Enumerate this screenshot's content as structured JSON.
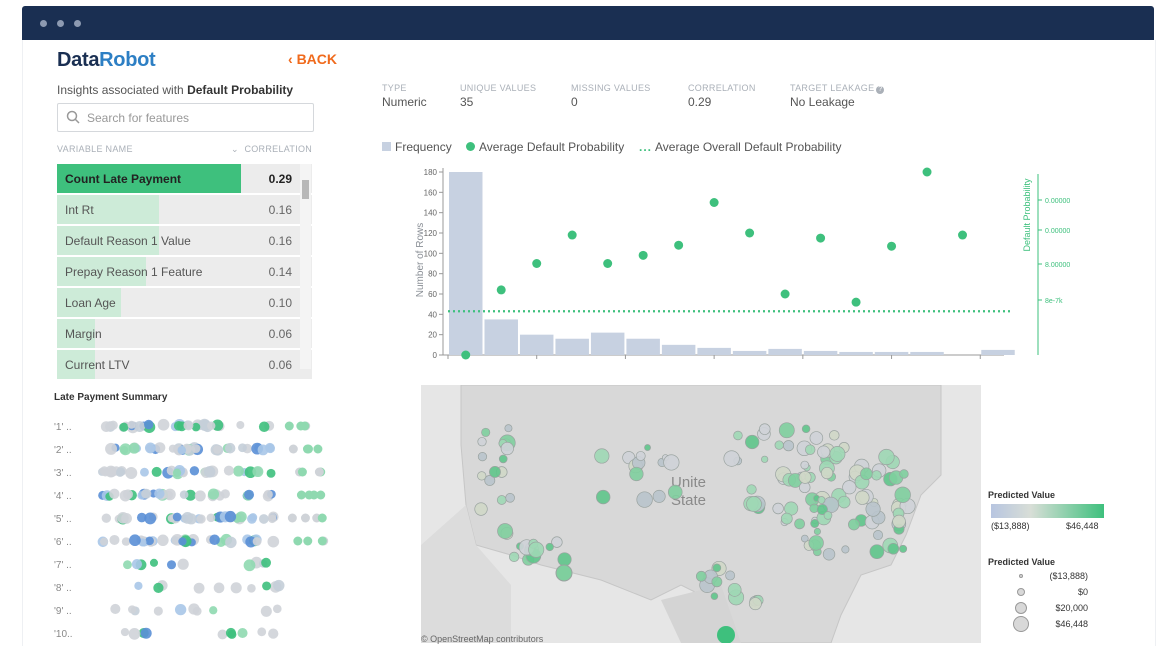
{
  "window": {
    "dots": [
      "dot",
      "dot",
      "dot"
    ]
  },
  "app": {
    "logo_data": "Data",
    "logo_robot": "Robot",
    "back_label": "BACK",
    "back_icon": "chevron-left-icon"
  },
  "insights": {
    "prefix": "Insights associated with ",
    "target": "Default Probability"
  },
  "search": {
    "placeholder": "Search for features",
    "icon": "search-icon"
  },
  "feature_table": {
    "col_name": "VARIABLE NAME",
    "col_corr": "CORRELATION",
    "sort_icon": "chevron-down-icon",
    "rows": [
      {
        "name": "Count Late Payment",
        "value": "0.29",
        "corr": 0.29,
        "selected": true
      },
      {
        "name": "Int Rt",
        "value": "0.16",
        "corr": 0.16
      },
      {
        "name": "Default Reason 1 Value",
        "value": "0.16",
        "corr": 0.16
      },
      {
        "name": "Prepay Reason 1 Feature",
        "value": "0.14",
        "corr": 0.14
      },
      {
        "name": "Loan Age",
        "value": "0.10",
        "corr": 0.1
      },
      {
        "name": "Margin",
        "value": "0.06",
        "corr": 0.06
      },
      {
        "name": "Current LTV",
        "value": "0.06",
        "corr": 0.06
      }
    ]
  },
  "stats": [
    {
      "label": "TYPE",
      "value": "Numeric"
    },
    {
      "label": "UNIQUE VALUES",
      "value": "35"
    },
    {
      "label": "MISSING VALUES",
      "value": "0"
    },
    {
      "label": "CORRELATION",
      "value": "0.29"
    },
    {
      "label": "TARGET LEAKAGE",
      "value": "No Leakage",
      "icon": "help-icon"
    }
  ],
  "legend": {
    "frequency": "Frequency",
    "avg_default": "Average Default Probability",
    "avg_overall": "Average Overall Default Probability"
  },
  "colors": {
    "accent": "#3ec07d",
    "bar": "#c7d1e1",
    "navy": "#1a2f52",
    "back": "#f06a1c"
  },
  "chart_data": {
    "type": "bar",
    "ylabel": "Number of Rows",
    "y2label": "Default Probability",
    "xlim": [
      0,
      31
    ],
    "ylim": [
      0,
      180
    ],
    "x_ticks": [
      "0",
      "5",
      "10",
      "15",
      "20",
      "25",
      "30"
    ],
    "y_ticks": [
      "0",
      "20",
      "40",
      "60",
      "80",
      "100",
      "120",
      "140",
      "160",
      "180"
    ],
    "y2_ticks": [
      "0.00000",
      "0.00000",
      "8.00000",
      "8e-7k"
    ],
    "series": [
      {
        "type": "bar",
        "x_start": [
          0,
          2,
          4,
          6,
          8,
          10,
          12,
          14,
          16,
          18,
          20,
          22,
          24,
          26,
          28,
          30
        ],
        "values": [
          180,
          35,
          20,
          16,
          22,
          16,
          10,
          7,
          4,
          6,
          4,
          3,
          3,
          3,
          0,
          5
        ]
      },
      {
        "type": "scatter",
        "x": [
          1,
          3,
          5,
          7,
          9,
          11,
          13,
          15,
          17,
          19,
          21,
          23,
          25,
          27,
          29
        ],
        "values": [
          0,
          64,
          90,
          118,
          90,
          98,
          108,
          150,
          120,
          60,
          115,
          52,
          107,
          180,
          118
        ]
      },
      {
        "type": "reference_line",
        "value": 43
      }
    ]
  },
  "late_payment": {
    "title": "Late Payment Summary",
    "rows": [
      {
        "label": "'1' .."
      },
      {
        "label": "'2' .."
      },
      {
        "label": "'3' .."
      },
      {
        "label": "'4' .."
      },
      {
        "label": "'5' .."
      },
      {
        "label": "'6' .."
      },
      {
        "label": "'7' .."
      },
      {
        "label": "'8' .."
      },
      {
        "label": "'9' .."
      },
      {
        "label": "'10.."
      }
    ]
  },
  "map": {
    "label_line1": "Unite",
    "label_line2": "State",
    "attribution": "© OpenStreetMap contributors",
    "legend_title": "Predicted Value",
    "legend_min": "($13,888)",
    "legend_max": "$46,448",
    "size_title": "Predicted Value",
    "size_labels": [
      "($13,888)",
      "$0",
      "$20,000",
      "$46,448"
    ]
  }
}
